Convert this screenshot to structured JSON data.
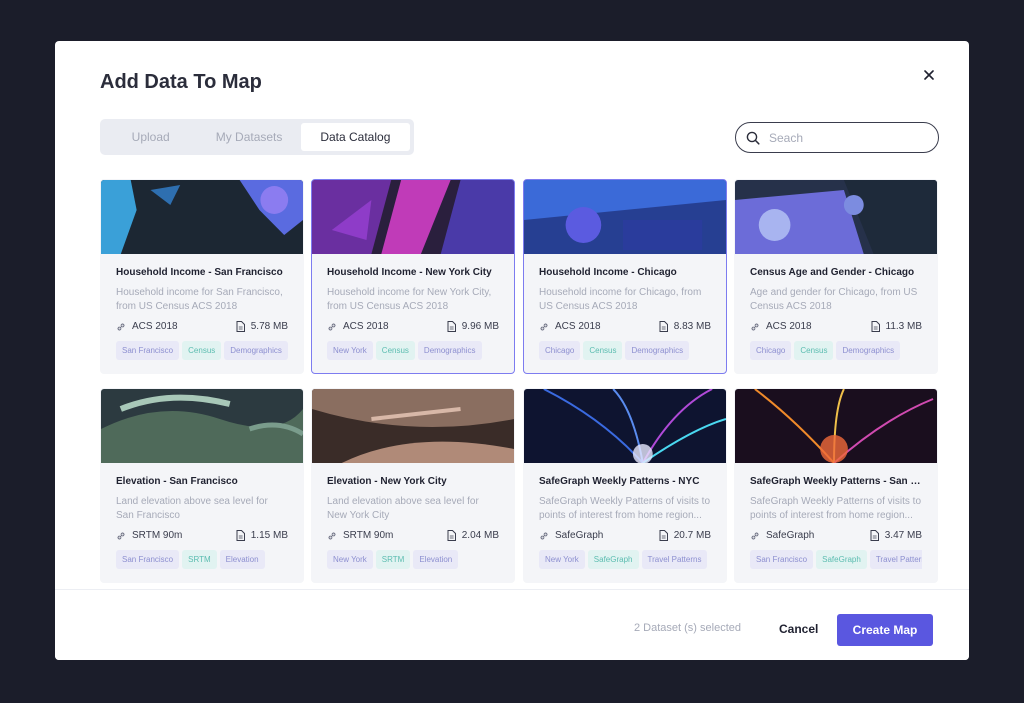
{
  "modal": {
    "title": "Add Data To Map",
    "tabs": [
      "Upload",
      "My Datasets",
      "Data Catalog"
    ],
    "active_tab": "Data Catalog",
    "search": {
      "placeholder": "Seach",
      "value": ""
    }
  },
  "cards": [
    {
      "title": "Household Income - San Francisco",
      "desc": "Household income for San Francisco, from US Census ACS 2018",
      "source": "ACS 2018",
      "size": "5.78 MB",
      "tags": [
        "San Francisco",
        "Census",
        "Demographics"
      ],
      "selected": false
    },
    {
      "title": "Household Income - New York City",
      "desc": "Household income for New York City, from US Census ACS 2018",
      "source": "ACS 2018",
      "size": "9.96 MB",
      "tags": [
        "New York",
        "Census",
        "Demographics"
      ],
      "selected": true
    },
    {
      "title": "Household Income - Chicago",
      "desc": "Household income for Chicago, from US Census ACS 2018",
      "source": "ACS 2018",
      "size": "8.83 MB",
      "tags": [
        "Chicago",
        "Census",
        "Demographics"
      ],
      "selected": true
    },
    {
      "title": "Census Age and Gender - Chicago",
      "desc": "Age and gender for Chicago, from US Census ACS 2018",
      "source": "ACS 2018",
      "size": "11.3 MB",
      "tags": [
        "Chicago",
        "Census",
        "Demographics"
      ],
      "selected": false
    },
    {
      "title": "Elevation - San Francisco",
      "desc": "Land elevation above sea level for San Francisco",
      "source": "SRTM 90m",
      "size": "1.15 MB",
      "tags": [
        "San Francisco",
        "SRTM",
        "Elevation"
      ],
      "selected": false
    },
    {
      "title": "Elevation - New York City",
      "desc": "Land elevation above sea level for New York City",
      "source": "SRTM 90m",
      "size": "2.04 MB",
      "tags": [
        "New York",
        "SRTM",
        "Elevation"
      ],
      "selected": false
    },
    {
      "title": "SafeGraph Weekly Patterns - NYC",
      "desc": "SafeGraph Weekly Patterns of visits to points of interest from home region...",
      "source": "SafeGraph",
      "size": "20.7 MB",
      "tags": [
        "New York",
        "SafeGraph",
        "Travel Patterns"
      ],
      "selected": false
    },
    {
      "title": "SafeGraph Weekly Patterns - San Fra...",
      "desc": "SafeGraph Weekly Patterns of visits to points of interest from home region...",
      "source": "SafeGraph",
      "size": "3.47 MB",
      "tags": [
        "San Francisco",
        "SafeGraph",
        "Travel Patterns"
      ],
      "selected": false
    }
  ],
  "footer": {
    "selected_text": "2 Dataset (s) selected",
    "cancel_label": "Cancel",
    "create_label": "Create Map"
  },
  "colors": {
    "accent": "#5a57e0",
    "selected_border": "#7d7cf0",
    "tag_blue": "#8d8fd0",
    "tag_teal": "#5cbdb0"
  },
  "icons": {
    "close": "close-icon",
    "search": "search-icon",
    "source": "link-icon",
    "size": "file-icon"
  }
}
